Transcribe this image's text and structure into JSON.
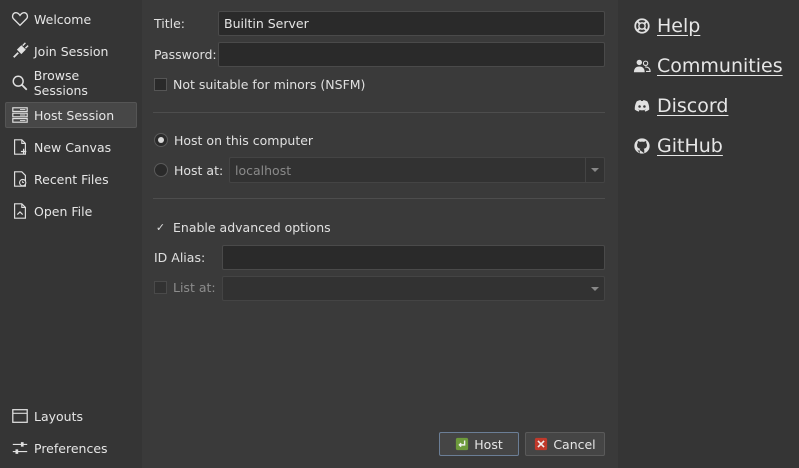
{
  "sidebar": {
    "items": [
      {
        "label": "Welcome",
        "icon": "heart-icon"
      },
      {
        "label": "Join Session",
        "icon": "plug-icon"
      },
      {
        "label": "Browse Sessions",
        "icon": "search-icon"
      },
      {
        "label": "Host Session",
        "icon": "server-icon",
        "active": true
      },
      {
        "label": "New Canvas",
        "icon": "new-document-icon"
      },
      {
        "label": "Recent Files",
        "icon": "recent-file-icon"
      },
      {
        "label": "Open File",
        "icon": "open-file-icon"
      }
    ],
    "bottom_items": [
      {
        "label": "Layouts",
        "icon": "layout-icon"
      },
      {
        "label": "Preferences",
        "icon": "sliders-icon"
      }
    ]
  },
  "form": {
    "title_label": "Title:",
    "title_value": "Builtin Server",
    "password_label": "Password:",
    "password_value": "",
    "nsfm_label": "Not suitable for minors (NSFM)",
    "nsfm_checked": false,
    "host_local_label": "Host on this computer",
    "host_at_label": "Host at:",
    "host_at_value": "localhost",
    "advanced_label": "Enable advanced options",
    "advanced_checked": true,
    "advanced_check_glyph": "✓",
    "id_alias_label": "ID Alias:",
    "id_alias_value": "",
    "list_at_label": "List at:",
    "list_at_value": ""
  },
  "buttons": {
    "host_label": "Host",
    "cancel_label": "Cancel"
  },
  "links": [
    {
      "label": "Help",
      "icon": "lifebuoy-icon"
    },
    {
      "label": "Communities",
      "icon": "users-icon"
    },
    {
      "label": "Discord",
      "icon": "discord-icon"
    },
    {
      "label": "GitHub",
      "icon": "github-icon"
    }
  ]
}
